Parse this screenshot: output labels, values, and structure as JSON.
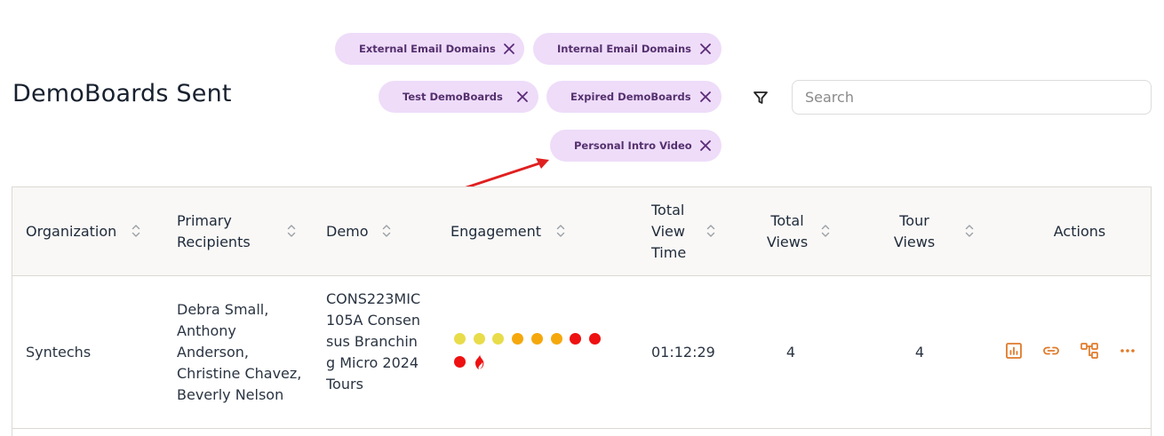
{
  "page": {
    "title": "DemoBoards Sent"
  },
  "filters": {
    "chips": [
      {
        "label": "External Email Domains"
      },
      {
        "label": "Internal Email Domains"
      },
      {
        "label": "Test DemoBoards"
      },
      {
        "label": "Expired DemoBoards"
      },
      {
        "label": "Personal Intro Video"
      }
    ]
  },
  "search": {
    "placeholder": "Search",
    "value": ""
  },
  "colors": {
    "chip_bg": "#eedcf9",
    "chip_text": "#55306e",
    "action_icon": "#e07a2a",
    "annotation_arrow": "#e02020",
    "engagement_yellow": "#e8dc4a",
    "engagement_orange": "#f5a80c",
    "engagement_red": "#ee1111"
  },
  "table": {
    "columns": [
      {
        "label": "Organization",
        "sortable": true
      },
      {
        "label": "Primary Recipients",
        "sortable": true
      },
      {
        "label": "Demo",
        "sortable": true
      },
      {
        "label": "Engagement",
        "sortable": true
      },
      {
        "label": "Total View Time",
        "sortable": true
      },
      {
        "label": "Total Views",
        "sortable": true
      },
      {
        "label": "Tour Views",
        "sortable": true
      },
      {
        "label": "Actions",
        "sortable": false
      }
    ],
    "rows": [
      {
        "organization": "Syntechs",
        "recipients": "Debra Small, Anthony Anderson, Christine Chavez, Beverly Nelson",
        "demo": "CONS223MIC105A Consensus Branching Micro 2024 Tours",
        "engagement": {
          "levels": [
            "yellow",
            "yellow",
            "yellow",
            "orange",
            "orange",
            "orange",
            "red",
            "red",
            "red"
          ],
          "hot_icon": "flame-icon"
        },
        "total_view_time": "01:12:29",
        "total_views": "4",
        "tour_views": "4",
        "actions": [
          "analytics-icon",
          "link-icon",
          "flow-icon",
          "more-icon"
        ]
      }
    ]
  }
}
